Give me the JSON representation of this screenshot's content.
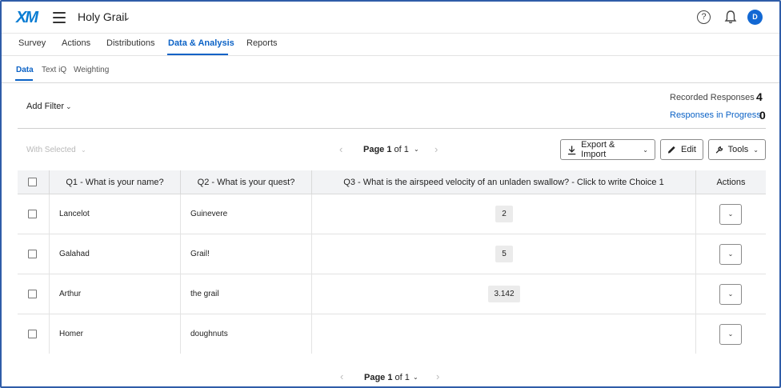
{
  "app": {
    "logo": "XM",
    "project_name": "Holy Grail",
    "avatar_initial": "D",
    "accent_color": "#0b62c6"
  },
  "main_tabs": [
    {
      "label": "Survey"
    },
    {
      "label": "Actions"
    },
    {
      "label": "Distributions"
    },
    {
      "label": "Data & Analysis",
      "active": true
    },
    {
      "label": "Reports"
    }
  ],
  "sub_tabs": [
    {
      "label": "Data",
      "active": true
    },
    {
      "label": "Text iQ"
    },
    {
      "label": "Weighting"
    }
  ],
  "filter": {
    "add_filter_label": "Add Filter"
  },
  "stats": {
    "recorded_label": "Recorded Responses",
    "recorded_count": "4",
    "in_progress_label": "Responses in Progress",
    "in_progress_count": "0"
  },
  "toolbar": {
    "with_selected_label": "With Selected",
    "page_label": "Page",
    "page_current": "1",
    "page_of": "of",
    "page_total": "1",
    "export_label": "Export & Import",
    "edit_label": "Edit",
    "tools_label": "Tools"
  },
  "table": {
    "headers": [
      "Q1 - What is your name?",
      "Q2 - What is your quest?",
      "Q3 - What is the airspeed velocity of an unladen swallow? - Click to write Choice 1",
      "Actions"
    ],
    "rows": [
      {
        "q1": "Lancelot",
        "q2": "Guinevere",
        "q3": "2"
      },
      {
        "q1": "Galahad",
        "q2": "Grail!",
        "q3": "5"
      },
      {
        "q1": "Arthur",
        "q2": "the grail",
        "q3": "3.142"
      },
      {
        "q1": "Homer",
        "q2": "doughnuts",
        "q3": ""
      }
    ]
  },
  "icons": {
    "menu": "hamburger-menu-icon",
    "help": "help-icon",
    "bell": "bell-icon",
    "download": "download-icon",
    "pencil": "pencil-icon",
    "wrench": "wrench-icon"
  }
}
